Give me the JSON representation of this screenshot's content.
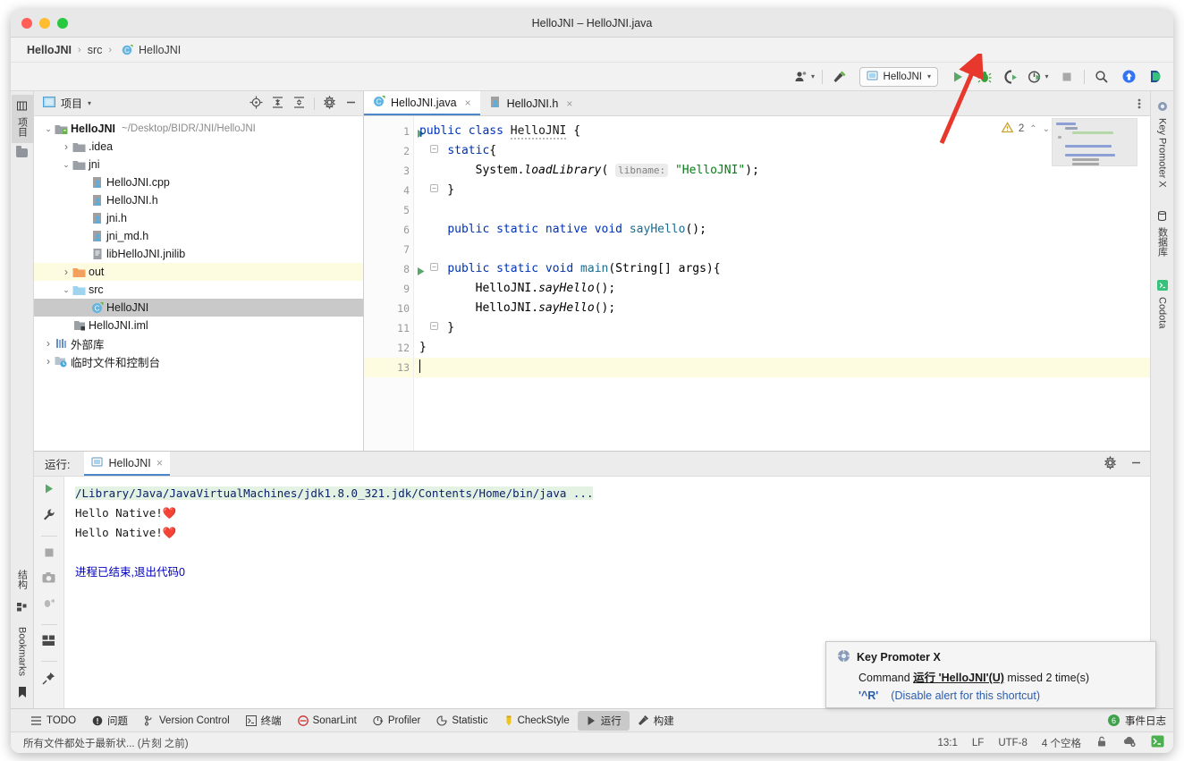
{
  "window": {
    "title": "HelloJNI – HelloJNI.java",
    "traffic_lights": [
      "close-red",
      "minimize-yellow",
      "maximize-green"
    ]
  },
  "breadcrumb": {
    "project": "HelloJNI",
    "folder": "src",
    "file": "HelloJNI",
    "separator": "›"
  },
  "toolbar": {
    "user_icon": "user-icon",
    "build_icon": "hammer-icon",
    "run_config": "HelloJNI",
    "run_label": "run-icon",
    "debug_label": "debug-icon",
    "coverage_label": "run-with-coverage-icon",
    "profile_label": "profile-icon",
    "stop_label": "stop-icon",
    "search_label": "search-icon",
    "update_label": "update-icon",
    "codota_label": "codota-icon"
  },
  "left_strip": {
    "tabs": [
      {
        "label": "项目",
        "icon": "project-icon",
        "active": true
      },
      {
        "label": "结构",
        "icon": "structure-icon",
        "active": false
      },
      {
        "label": "Bookmarks",
        "icon": "bookmark-icon",
        "active": false
      }
    ]
  },
  "right_strip": {
    "tabs": [
      {
        "label": "Key Promoter X",
        "icon": "key-promoter-icon"
      },
      {
        "label": "数据库",
        "icon": "database-icon"
      },
      {
        "label": "Codota",
        "icon": "codota-icon"
      }
    ]
  },
  "project_panel": {
    "title": "项目",
    "dropdown_caret": "▾",
    "icons": [
      "locate-icon",
      "expand-all-icon",
      "collapse-all-icon",
      "settings-icon",
      "hide-icon"
    ],
    "tree": [
      {
        "depth": 0,
        "arrow": "v",
        "icon": "folder-module",
        "label": "HelloJNI",
        "bold": true,
        "path": "~/Desktop/BIDR/JNI/HelloJNI",
        "state": ""
      },
      {
        "depth": 1,
        "arrow": ">",
        "icon": "folder-gray",
        "label": ".idea",
        "bold": false,
        "path": "",
        "state": ""
      },
      {
        "depth": 1,
        "arrow": "v",
        "icon": "folder-gray",
        "label": "jni",
        "bold": false,
        "path": "",
        "state": ""
      },
      {
        "depth": 2,
        "arrow": "",
        "icon": "cpp-file",
        "label": "HelloJNI.cpp",
        "bold": false,
        "path": "",
        "state": ""
      },
      {
        "depth": 2,
        "arrow": "",
        "icon": "cpp-file",
        "label": "HelloJNI.h",
        "bold": false,
        "path": "",
        "state": ""
      },
      {
        "depth": 2,
        "arrow": "",
        "icon": "cpp-file",
        "label": "jni.h",
        "bold": false,
        "path": "",
        "state": ""
      },
      {
        "depth": 2,
        "arrow": "",
        "icon": "cpp-file",
        "label": "jni_md.h",
        "bold": false,
        "path": "",
        "state": ""
      },
      {
        "depth": 2,
        "arrow": "",
        "icon": "binary-file",
        "label": "libHelloJNI.jnilib",
        "bold": false,
        "path": "",
        "state": ""
      },
      {
        "depth": 1,
        "arrow": ">",
        "icon": "folder-orange",
        "label": "out",
        "bold": false,
        "path": "",
        "state": "hl"
      },
      {
        "depth": 1,
        "arrow": "v",
        "icon": "folder-blue",
        "label": "src",
        "bold": false,
        "path": "",
        "state": ""
      },
      {
        "depth": 2,
        "arrow": "",
        "icon": "java-class",
        "label": "HelloJNI",
        "bold": false,
        "path": "",
        "state": "sel"
      },
      {
        "depth": 1,
        "arrow": "",
        "icon": "iml-file",
        "label": "HelloJNI.iml",
        "bold": false,
        "path": "",
        "state": ""
      },
      {
        "depth": 0,
        "arrow": ">",
        "icon": "library-icon",
        "label": "外部库",
        "bold": false,
        "path": "",
        "state": ""
      },
      {
        "depth": 0,
        "arrow": ">",
        "icon": "scratch-icon",
        "label": "临时文件和控制台",
        "bold": false,
        "path": "",
        "state": ""
      }
    ]
  },
  "editor": {
    "tabs": [
      {
        "label": "HelloJNI.java",
        "icon": "java-class-icon",
        "active": true,
        "close": "×"
      },
      {
        "label": "HelloJNI.h",
        "icon": "cpp-header-icon",
        "active": false,
        "close": "×"
      }
    ],
    "more_icon": "more-vertical-icon",
    "inspection": {
      "warning_count": "2",
      "warning_icon": "warning-triangle-icon",
      "up": "⌃",
      "down": "⌄"
    },
    "caret_position": "13:1",
    "lines": [
      {
        "n": "1",
        "run_marker": true,
        "fold": "",
        "current": false
      },
      {
        "n": "2",
        "run_marker": false,
        "fold": "-",
        "current": false
      },
      {
        "n": "3",
        "run_marker": false,
        "fold": "",
        "current": false
      },
      {
        "n": "4",
        "run_marker": false,
        "fold": "-",
        "current": false
      },
      {
        "n": "5",
        "run_marker": false,
        "fold": "",
        "current": false
      },
      {
        "n": "6",
        "run_marker": false,
        "fold": "",
        "current": false
      },
      {
        "n": "7",
        "run_marker": false,
        "fold": "",
        "current": false
      },
      {
        "n": "8",
        "run_marker": true,
        "fold": "-",
        "current": false
      },
      {
        "n": "9",
        "run_marker": false,
        "fold": "",
        "current": false
      },
      {
        "n": "10",
        "run_marker": false,
        "fold": "",
        "current": false
      },
      {
        "n": "11",
        "run_marker": false,
        "fold": "-",
        "current": false
      },
      {
        "n": "12",
        "run_marker": false,
        "fold": "",
        "current": false
      },
      {
        "n": "13",
        "run_marker": false,
        "fold": "",
        "current": true
      }
    ],
    "code_text": [
      "public class HelloJNI {",
      "    static{",
      "        System.loadLibrary( libname: \"HelloJNI\");",
      "    }",
      "",
      "    public static native void sayHello();",
      "",
      "    public static void main(String[] args){",
      "        HelloJNI.sayHello();",
      "        HelloJNI.sayHello();",
      "    }",
      "}",
      ""
    ],
    "parameter_hint": "libname:",
    "string_literal": "\"HelloJNI\""
  },
  "run_panel": {
    "title": "运行:",
    "tab_label": "HelloJNI",
    "tab_close": "×",
    "header_icons": [
      "settings-icon",
      "hide-icon"
    ],
    "side_icons": [
      "rerun-icon",
      "wrench-icon",
      "stop-icon",
      "camera-icon",
      "dump-threads-icon",
      "layout-icon",
      "pin-icon"
    ],
    "console": [
      {
        "type": "cmd",
        "text": "/Library/Java/JavaVirtualMachines/jdk1.8.0_321.jdk/Contents/Home/bin/java ..."
      },
      {
        "type": "out",
        "text": "Hello Native!❤️"
      },
      {
        "type": "out",
        "text": "Hello Native!❤️"
      },
      {
        "type": "blank",
        "text": ""
      },
      {
        "type": "exit",
        "text": "进程已结束,退出代码0"
      }
    ]
  },
  "notification": {
    "icon": "key-promoter-icon",
    "title": "Key Promoter X",
    "body_prefix": "Command ",
    "body_link": "运行 'HelloJNI'(U)",
    "body_suffix": " missed 2 time(s)",
    "shortcut": "'^R'",
    "action": "(Disable alert for this shortcut)"
  },
  "tool_window_bar": {
    "items": [
      {
        "label": "TODO",
        "icon": "todo-icon",
        "active": false
      },
      {
        "label": "问题",
        "icon": "problems-icon",
        "active": false
      },
      {
        "label": "Version Control",
        "icon": "vcs-icon",
        "active": false
      },
      {
        "label": "终端",
        "icon": "terminal-icon",
        "active": false
      },
      {
        "label": "SonarLint",
        "icon": "sonarlint-icon",
        "active": false
      },
      {
        "label": "Profiler",
        "icon": "profiler-icon",
        "active": false
      },
      {
        "label": "Statistic",
        "icon": "statistic-icon",
        "active": false
      },
      {
        "label": "CheckStyle",
        "icon": "checkstyle-icon",
        "active": false
      },
      {
        "label": "运行",
        "icon": "run-icon",
        "active": true
      },
      {
        "label": "构建",
        "icon": "build-icon",
        "active": false
      }
    ],
    "event_log": {
      "label": "事件日志",
      "badge": "6"
    }
  },
  "status_bar": {
    "message": "所有文件都处于最新状... (片刻 之前)",
    "caret": "13:1",
    "line_sep": "LF",
    "encoding": "UTF-8",
    "indent": "4 个空格",
    "icons": [
      "lock-icon",
      "cloud-icon",
      "terminal-icon"
    ]
  },
  "colors": {
    "accent_blue": "#4a86c8",
    "keyword": "#0033b3",
    "string": "#067d17",
    "method": "#1a6b8f",
    "highlight_row": "#fdfbe0",
    "selection": "#c9c9c9",
    "arrow_red": "#e8372c"
  }
}
